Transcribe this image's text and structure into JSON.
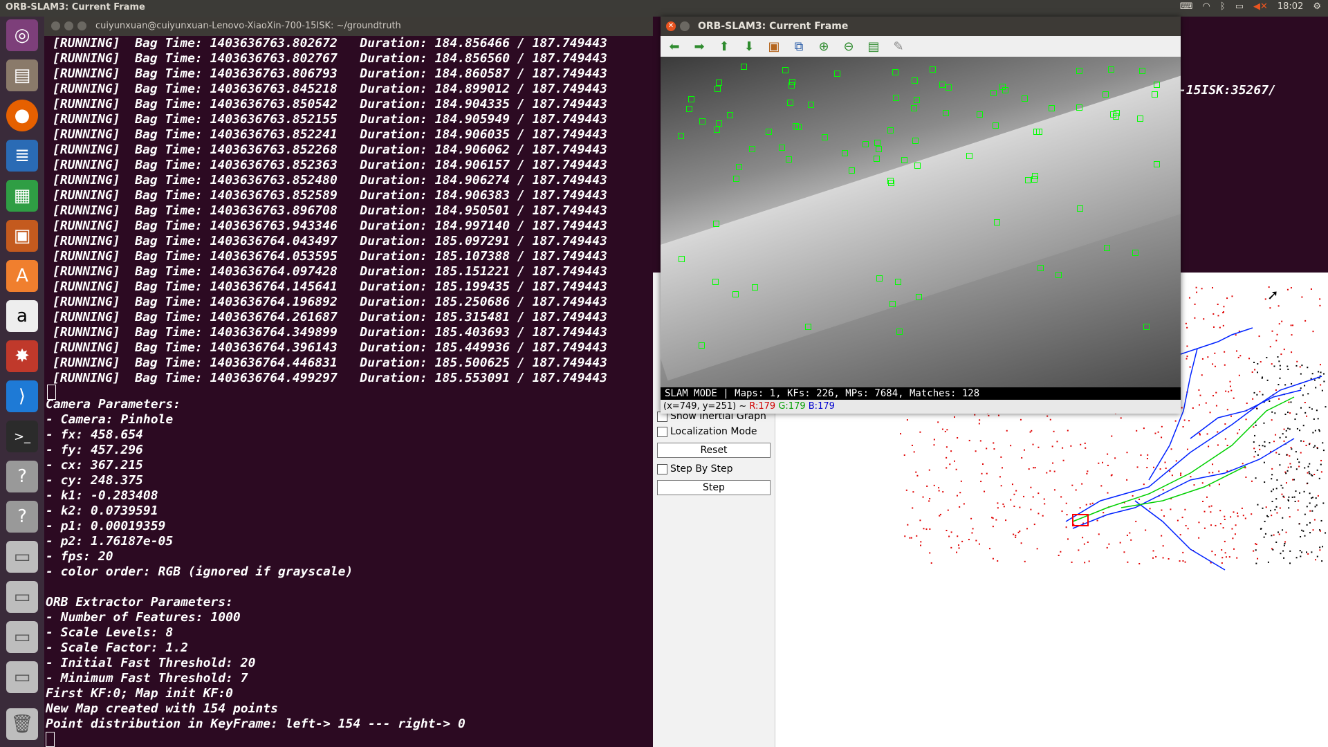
{
  "topbar": {
    "title": "ORB-SLAM3: Current Frame",
    "time": "18:02",
    "icons": [
      "keyboard-icon",
      "wifi-icon",
      "bluetooth-icon",
      "battery-icon",
      "volume-muted-icon",
      "gear-icon"
    ]
  },
  "launcher": {
    "items": [
      "ubuntu-logo-icon",
      "files-icon",
      "firefox-icon",
      "writer-icon",
      "calc-icon",
      "impress-icon",
      "software-center-icon",
      "amazon-icon",
      "settings-icon",
      "vscode-icon",
      "terminal-icon",
      "unknown-app-icon",
      "unknown-app-icon",
      "drive-icon",
      "drive-icon",
      "drive-icon",
      "drive-icon",
      "trash-icon"
    ]
  },
  "terminal": {
    "title": "cuiyunxuan@cuiyunxuan-Lenovo-XiaoXin-700-15ISK: ~/groundtruth",
    "running_lines": [
      "[RUNNING]  Bag Time: 1403636763.802672   Duration: 184.856466 / 187.749443",
      "[RUNNING]  Bag Time: 1403636763.802767   Duration: 184.856560 / 187.749443",
      "[RUNNING]  Bag Time: 1403636763.806793   Duration: 184.860587 / 187.749443",
      "[RUNNING]  Bag Time: 1403636763.845218   Duration: 184.899012 / 187.749443",
      "[RUNNING]  Bag Time: 1403636763.850542   Duration: 184.904335 / 187.749443",
      "[RUNNING]  Bag Time: 1403636763.852155   Duration: 184.905949 / 187.749443",
      "[RUNNING]  Bag Time: 1403636763.852241   Duration: 184.906035 / 187.749443",
      "[RUNNING]  Bag Time: 1403636763.852268   Duration: 184.906062 / 187.749443",
      "[RUNNING]  Bag Time: 1403636763.852363   Duration: 184.906157 / 187.749443",
      "[RUNNING]  Bag Time: 1403636763.852480   Duration: 184.906274 / 187.749443",
      "[RUNNING]  Bag Time: 1403636763.852589   Duration: 184.906383 / 187.749443",
      "[RUNNING]  Bag Time: 1403636763.896708   Duration: 184.950501 / 187.749443",
      "[RUNNING]  Bag Time: 1403636763.943346   Duration: 184.997140 / 187.749443",
      "[RUNNING]  Bag Time: 1403636764.043497   Duration: 185.097291 / 187.749443",
      "[RUNNING]  Bag Time: 1403636764.053595   Duration: 185.107388 / 187.749443",
      "[RUNNING]  Bag Time: 1403636764.097428   Duration: 185.151221 / 187.749443",
      "[RUNNING]  Bag Time: 1403636764.145641   Duration: 185.199435 / 187.749443",
      "[RUNNING]  Bag Time: 1403636764.196892   Duration: 185.250686 / 187.749443",
      "[RUNNING]  Bag Time: 1403636764.261687   Duration: 185.315481 / 187.749443",
      "[RUNNING]  Bag Time: 1403636764.349899   Duration: 185.403693 / 187.749443",
      "[RUNNING]  Bag Time: 1403636764.396143   Duration: 185.449936 / 187.749443",
      "[RUNNING]  Bag Time: 1403636764.446831   Duration: 185.500625 / 187.749443",
      "[RUNNING]  Bag Time: 1403636764.499297   Duration: 185.553091 / 187.749443"
    ],
    "param_lines": [
      "Camera Parameters:",
      "- Camera: Pinhole",
      "- fx: 458.654",
      "- fy: 457.296",
      "- cx: 367.215",
      "- cy: 248.375",
      "- k1: -0.283408",
      "- k2: 0.0739591",
      "- p1: 0.00019359",
      "- p2: 1.76187e-05",
      "- fps: 20",
      "- color order: RGB (ignored if grayscale)",
      "",
      "ORB Extractor Parameters:",
      "- Number of Features: 1000",
      "- Scale Levels: 8",
      "- Scale Factor: 1.2",
      "- Initial Fast Threshold: 20",
      "- Minimum Fast Threshold: 7",
      "First KF:0; Map init KF:0",
      "New Map created with 154 points",
      "Point distribution in KeyFrame: left-> 154 --- right-> 0"
    ]
  },
  "right_terminal": {
    "fragment": "-15ISK:35267/"
  },
  "map_viewer": {
    "show_inertial_label": "Show Inertial Graph",
    "localization_label": "Localization Mode",
    "reset_label": "Reset",
    "step_by_step_label": "Step By Step",
    "step_label": "Step"
  },
  "frame_window": {
    "title": "ORB-SLAM3: Current Frame",
    "toolbar": [
      "arrow-left-icon",
      "arrow-right-icon",
      "arrow-up-icon",
      "arrow-down-icon",
      "image-icon",
      "zoom-fit-icon",
      "zoom-in-icon",
      "zoom-out-icon",
      "save-icon",
      "brush-icon"
    ],
    "status": "SLAM MODE |  Maps: 1, KFs: 226, MPs: 7684, Matches: 128",
    "coords": "(x=749, y=251) ~ ",
    "r": "R:179",
    "g": "G:179",
    "b": "B:179"
  },
  "colors": {
    "keypoint": "#00ff00",
    "terminal_bg": "#2c0a22",
    "accent": "#e95420"
  }
}
